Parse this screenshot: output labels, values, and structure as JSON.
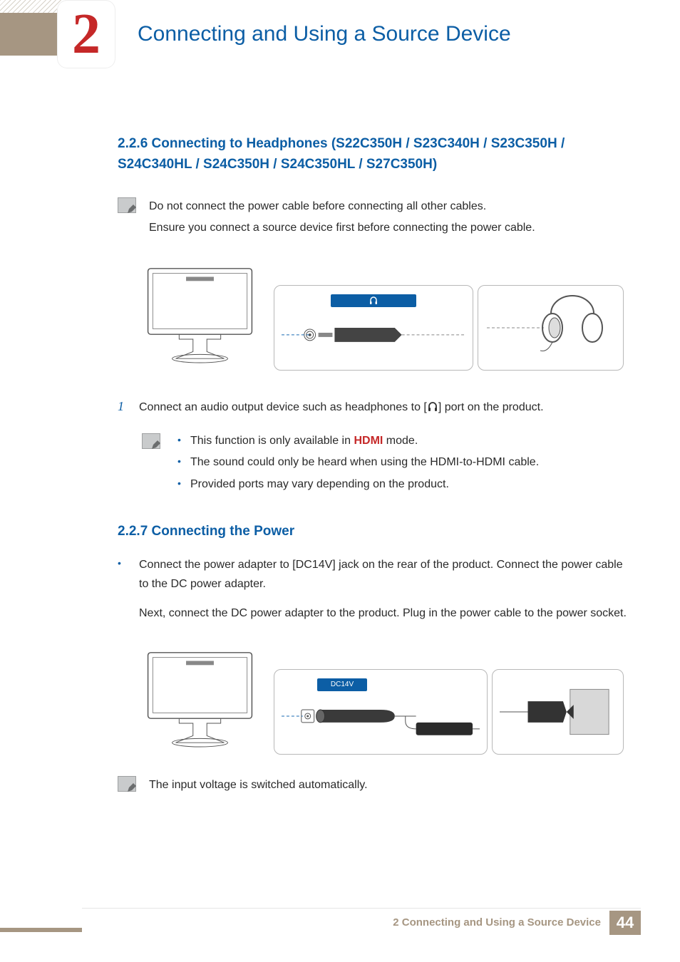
{
  "chapter": {
    "number": "2",
    "title": "Connecting and Using a Source Device"
  },
  "section_226": {
    "heading": "2.2.6   Connecting to Headphones (S22C350H / S23C340H / S23C350H / S24C340HL / S24C350H / S24C350HL / S27C350H)",
    "note_line1": "Do not connect the power cable before connecting all other cables.",
    "note_line2": "Ensure you connect a source device first before connecting the power cable.",
    "step1_num": "1",
    "step1_before": "Connect an audio output device such as headphones  to [",
    "step1_after": "] port on the product.",
    "bullets": {
      "b1_before": "This function is only available in ",
      "b1_hdmi": "HDMI",
      "b1_after": " mode.",
      "b2": "The sound could only be heard when using the HDMI-to-HDMI cable.",
      "b3": "Provided ports may vary depending on the product."
    }
  },
  "section_227": {
    "heading": "2.2.7   Connecting the Power",
    "bullet_text": "Connect the power adapter to [DC14V] jack on the rear of the product. Connect the power cable to the DC power adapter.",
    "cont_text": "Next, connect the DC power adapter to the product. Plug in the power cable to the power socket.",
    "port_label": "DC14V",
    "note": "The input voltage is switched automatically."
  },
  "footer": {
    "text": "2 Connecting and Using a Source Device",
    "page": "44"
  }
}
